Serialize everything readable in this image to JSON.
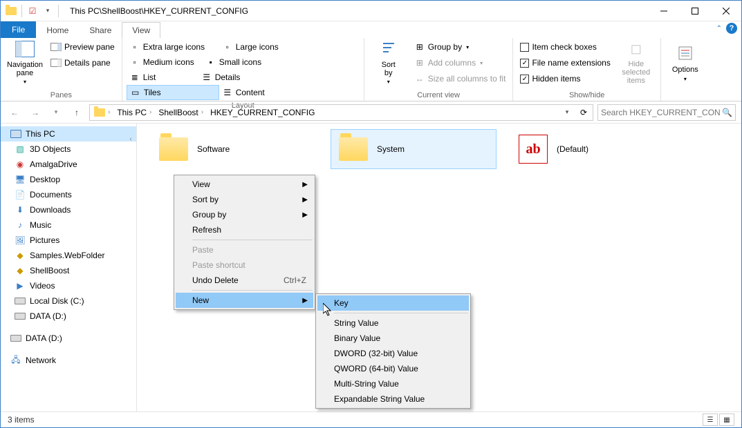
{
  "title": "This PC\\ShellBoost\\HKEY_CURRENT_CONFIG",
  "tabs": {
    "file": "File",
    "home": "Home",
    "share": "Share",
    "view": "View"
  },
  "ribbon": {
    "panes": {
      "nav": "Navigation\npane",
      "preview": "Preview pane",
      "details": "Details pane",
      "group": "Panes"
    },
    "layout": {
      "xlarge": "Extra large icons",
      "large": "Large icons",
      "medium": "Medium icons",
      "small": "Small icons",
      "list": "List",
      "details": "Details",
      "tiles": "Tiles",
      "content": "Content",
      "group": "Layout"
    },
    "currentview": {
      "sortby": "Sort\nby",
      "groupby": "Group by",
      "addcols": "Add columns",
      "sizeall": "Size all columns to fit",
      "group": "Current view"
    },
    "showhide": {
      "itemchk": "Item check boxes",
      "fileext": "File name extensions",
      "hidden": "Hidden items",
      "hidesel": "Hide selected\nitems",
      "group": "Show/hide"
    },
    "options": "Options"
  },
  "breadcrumb": [
    "This PC",
    "ShellBoost",
    "HKEY_CURRENT_CONFIG"
  ],
  "search_placeholder": "Search HKEY_CURRENT_CON",
  "sidebar": {
    "root": "This PC",
    "items": [
      "3D Objects",
      "AmalgaDrive",
      "Desktop",
      "Documents",
      "Downloads",
      "Music",
      "Pictures",
      "Samples.WebFolder",
      "ShellBoost",
      "Videos",
      "Local Disk (C:)",
      "DATA (D:)"
    ],
    "extra": "DATA (D:)",
    "network": "Network"
  },
  "tiles": [
    {
      "label": "Software",
      "type": "folder"
    },
    {
      "label": "System",
      "type": "folder",
      "selected": true
    },
    {
      "label": "(Default)",
      "type": "string"
    }
  ],
  "status": "3 items",
  "context_menu": {
    "items": [
      {
        "label": "View",
        "arrow": true
      },
      {
        "label": "Sort by",
        "arrow": true
      },
      {
        "label": "Group by",
        "arrow": true
      },
      {
        "label": "Refresh"
      },
      {
        "sep": true
      },
      {
        "label": "Paste",
        "disabled": true
      },
      {
        "label": "Paste shortcut",
        "disabled": true
      },
      {
        "label": "Undo Delete",
        "shortcut": "Ctrl+Z"
      },
      {
        "sep": true
      },
      {
        "label": "New",
        "arrow": true,
        "highlight": true
      }
    ]
  },
  "submenu": {
    "items": [
      {
        "label": "Key",
        "highlight": true
      },
      {
        "sep": true
      },
      {
        "label": "String Value"
      },
      {
        "label": "Binary Value"
      },
      {
        "label": "DWORD (32-bit) Value"
      },
      {
        "label": "QWORD (64-bit) Value"
      },
      {
        "label": "Multi-String Value"
      },
      {
        "label": "Expandable String Value"
      }
    ]
  }
}
